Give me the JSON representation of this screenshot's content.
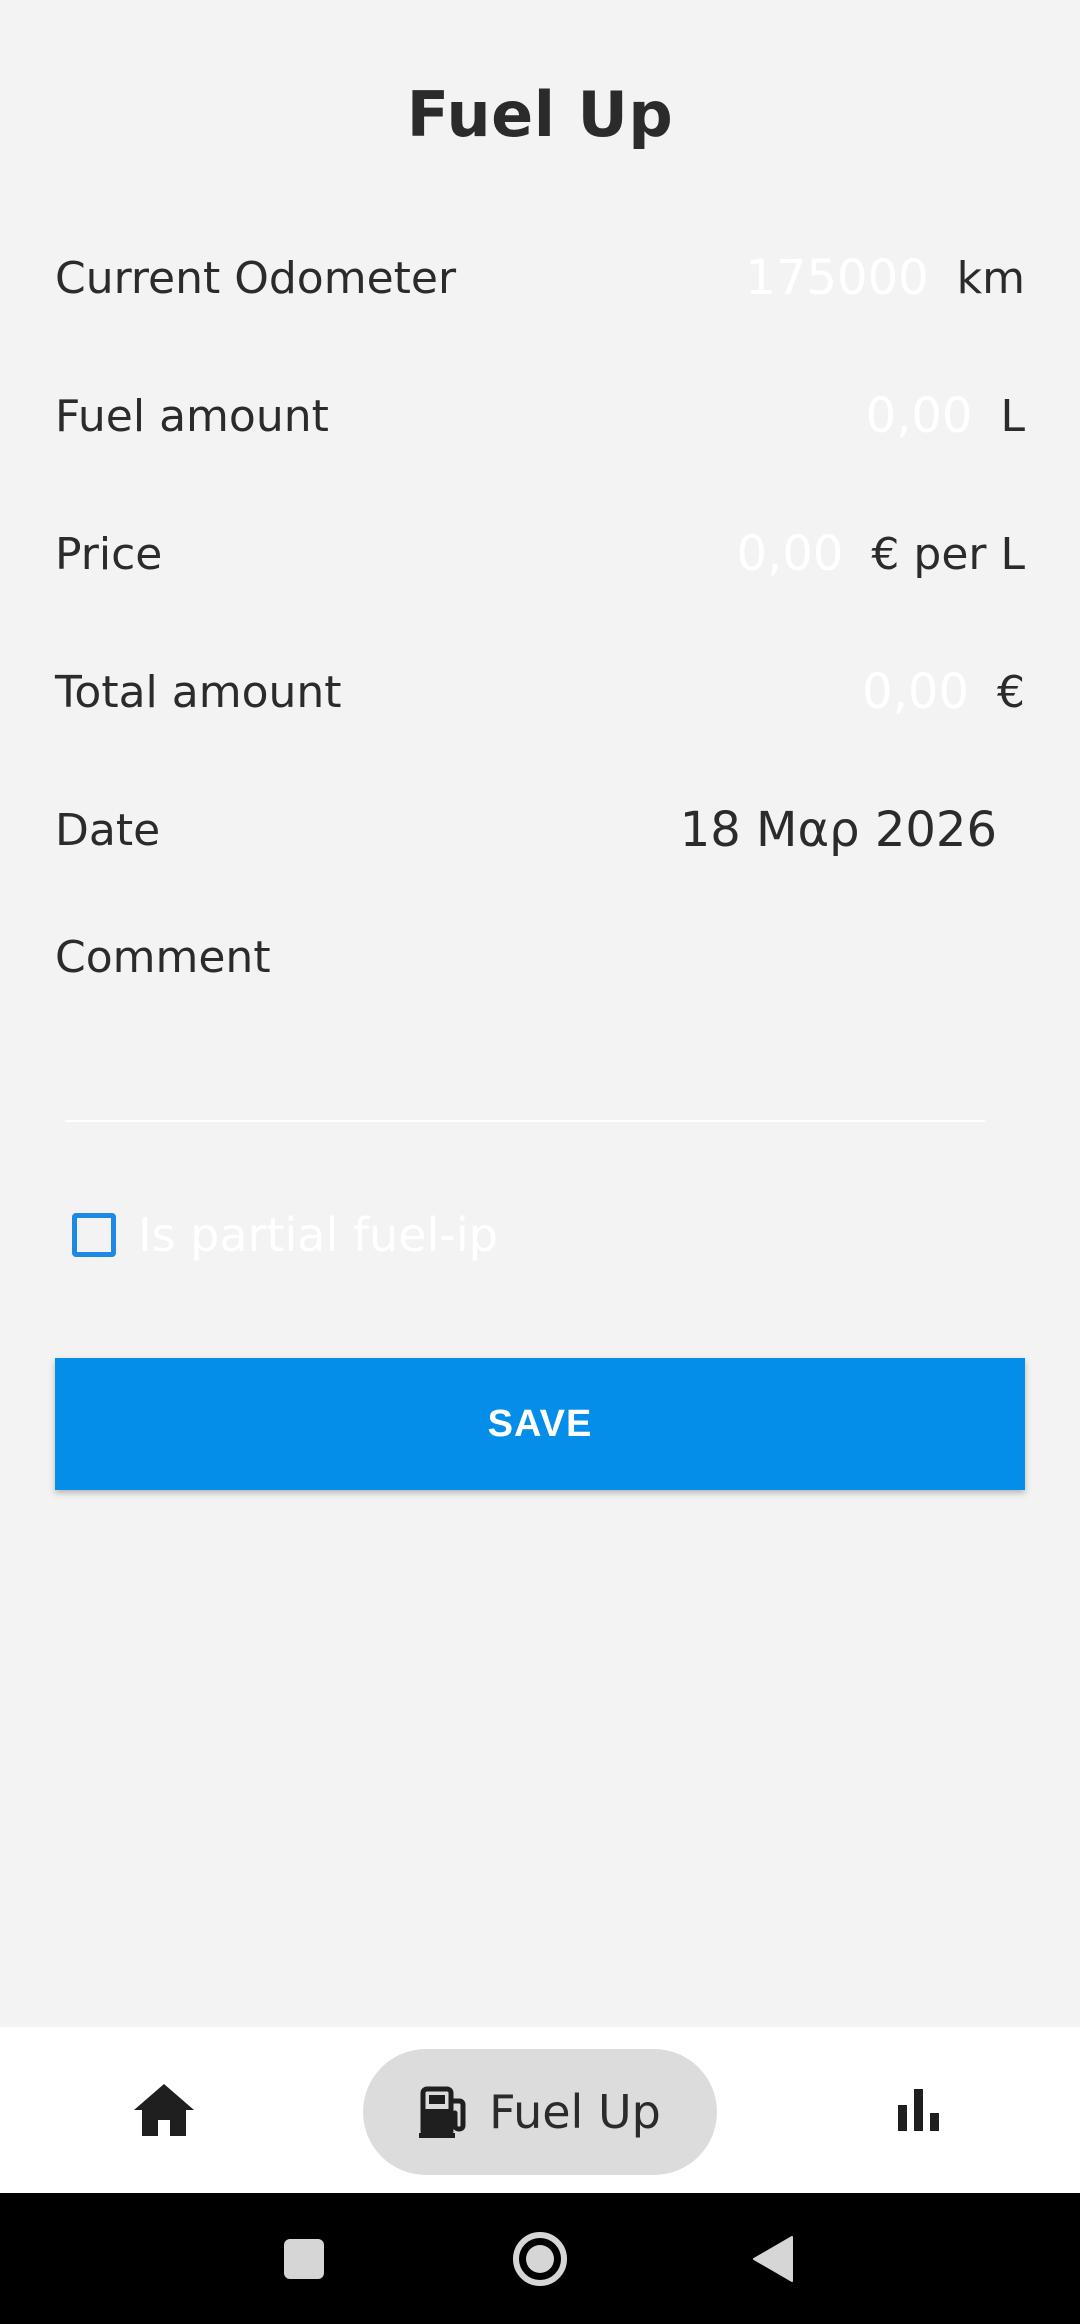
{
  "page": {
    "title": "Fuel Up"
  },
  "form": {
    "odometer": {
      "label": "Current Odometer",
      "placeholder": "175000",
      "value": "",
      "unit": "km"
    },
    "fuel_amount": {
      "label": "Fuel amount",
      "placeholder": "0,00",
      "value": "",
      "unit": "L"
    },
    "price": {
      "label": "Price",
      "placeholder": "0,00",
      "value": "",
      "unit": "€ per L"
    },
    "total_amount": {
      "label": "Total amount",
      "placeholder": "0,00",
      "value": "",
      "unit": "€"
    },
    "date": {
      "label": "Date",
      "value": "18 Μαρ 2026"
    },
    "comment": {
      "label": "Comment",
      "value": ""
    },
    "partial": {
      "label": "Is partial fuel-ip",
      "checked": false
    },
    "save_label": "SAVE"
  },
  "bottom_nav": {
    "items": [
      {
        "icon": "home-icon",
        "label": ""
      },
      {
        "icon": "fuel-pump-icon",
        "label": "Fuel Up",
        "selected": true
      },
      {
        "icon": "bar-chart-icon",
        "label": ""
      }
    ]
  },
  "system_nav": {
    "icons": [
      "recents-square-icon",
      "home-circle-icon",
      "back-triangle-icon"
    ]
  },
  "colors": {
    "background": "#f2f3f2",
    "accent": "#058ee9",
    "checkbox": "#1e88e5",
    "text": "#2b2b2b",
    "nav_pill": "#dcdcdc"
  }
}
